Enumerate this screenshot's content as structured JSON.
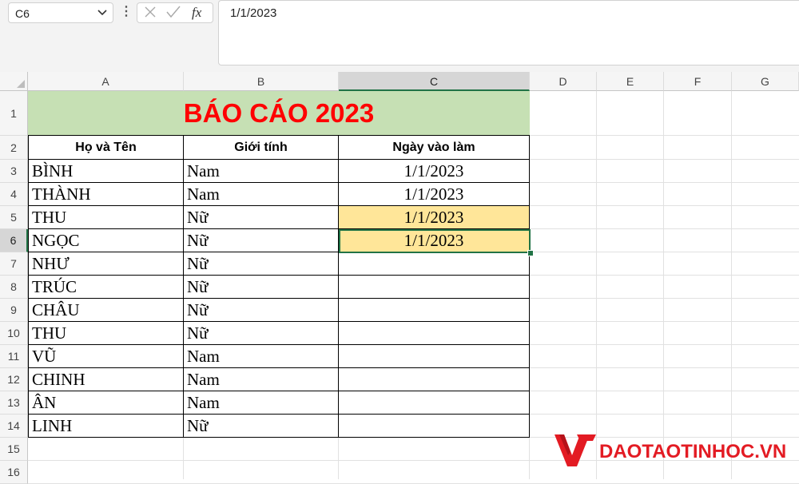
{
  "name_box": {
    "value": "C6"
  },
  "formula_bar": {
    "value": "1/1/2023",
    "fx_label": "fx"
  },
  "columns": [
    "A",
    "B",
    "C",
    "D",
    "E",
    "F",
    "G"
  ],
  "selected_column": "C",
  "rows": [
    "1",
    "2",
    "3",
    "4",
    "5",
    "6",
    "7",
    "8",
    "9",
    "10",
    "11",
    "12",
    "13",
    "14",
    "15",
    "16"
  ],
  "selected_row": "6",
  "sheet": {
    "title": "BÁO CÁO 2023",
    "headers": [
      "Họ và Tên",
      "Giới tính",
      "Ngày vào làm"
    ],
    "records": [
      {
        "name": "BÌNH",
        "gender": "Nam",
        "date": "1/1/2023"
      },
      {
        "name": "THÀNH",
        "gender": "Nam",
        "date": "1/1/2023"
      },
      {
        "name": "THU",
        "gender": "Nữ",
        "date": "1/1/2023"
      },
      {
        "name": "NGỌC",
        "gender": "Nữ",
        "date": "1/1/2023"
      },
      {
        "name": "NHƯ",
        "gender": "Nữ",
        "date": ""
      },
      {
        "name": "TRÚC",
        "gender": "Nữ",
        "date": ""
      },
      {
        "name": "CHÂU",
        "gender": "Nữ",
        "date": ""
      },
      {
        "name": "THU",
        "gender": "Nữ",
        "date": ""
      },
      {
        "name": "VŨ",
        "gender": "Nam",
        "date": ""
      },
      {
        "name": "CHINH",
        "gender": "Nam",
        "date": ""
      },
      {
        "name": "ÂN",
        "gender": "Nam",
        "date": ""
      },
      {
        "name": "LINH",
        "gender": "Nữ",
        "date": ""
      }
    ],
    "highlighted_rows": [
      2,
      3
    ],
    "highlight_color": "#ffe699",
    "title_fill": "#c6e0b4",
    "title_color": "#ff0000"
  },
  "logo": {
    "text": "DAOTAOTINHOC.VN",
    "color": "#e31b23"
  },
  "icons": {
    "name_box_dropdown": "chevron-down-icon",
    "cancel": "close-icon",
    "enter": "check-icon",
    "function": "fx-icon",
    "more": "more-vertical-icon"
  }
}
